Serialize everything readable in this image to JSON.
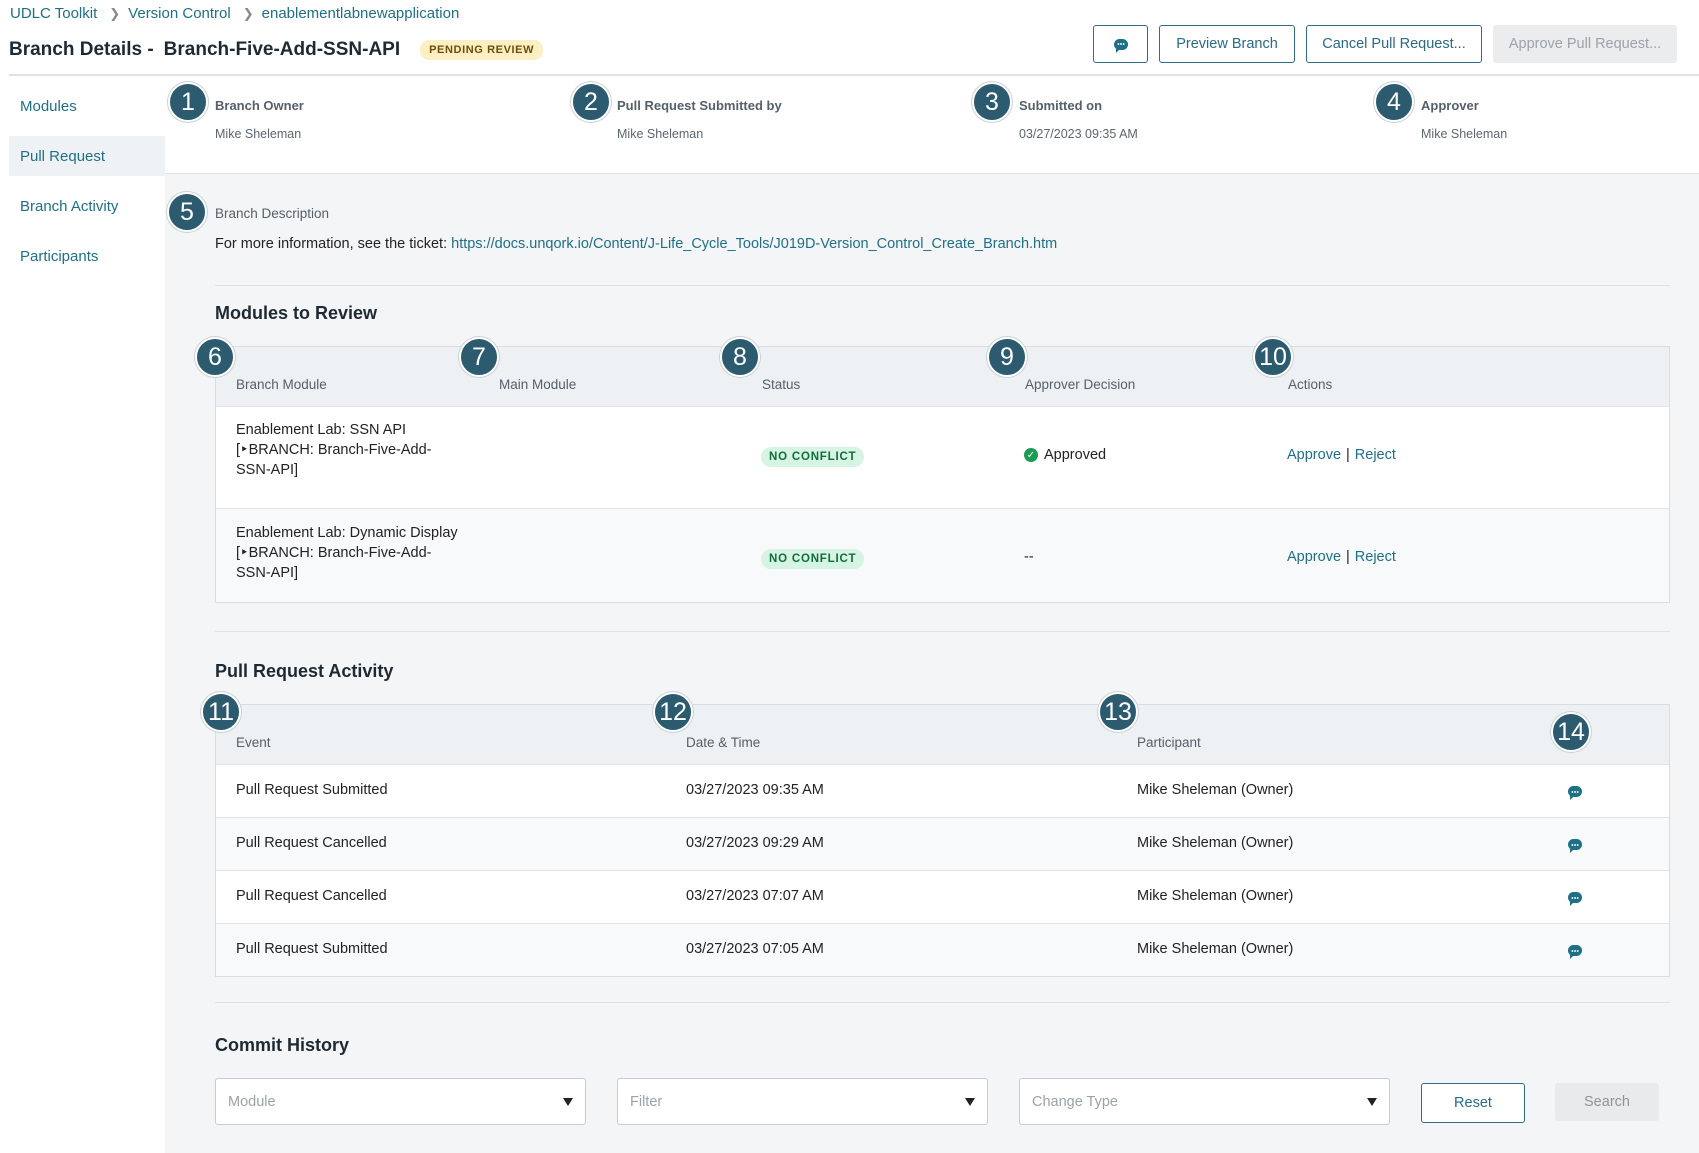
{
  "breadcrumb": [
    "UDLC Toolkit",
    "Version Control",
    "enablementlabnewapplication"
  ],
  "header": {
    "title_prefix": "Branch Details -",
    "branch_name": "Branch-Five-Add-SSN-API",
    "status_badge": "PENDING REVIEW"
  },
  "actions": {
    "comment_icon": "comment-icon",
    "preview": "Preview Branch",
    "cancel": "Cancel Pull Request...",
    "approve": "Approve Pull Request..."
  },
  "sidebar": {
    "items": [
      {
        "label": "Modules",
        "active": false
      },
      {
        "label": "Pull Request",
        "active": true
      },
      {
        "label": "Branch Activity",
        "active": false
      },
      {
        "label": "Participants",
        "active": false
      }
    ]
  },
  "info": [
    {
      "num": "1",
      "label": "Branch Owner",
      "value": "Mike Sheleman"
    },
    {
      "num": "2",
      "label": "Pull Request Submitted by",
      "value": "Mike Sheleman"
    },
    {
      "num": "3",
      "label": "Submitted on",
      "value": "03/27/2023 09:35 AM"
    },
    {
      "num": "4",
      "label": "Approver",
      "value": "Mike Sheleman"
    }
  ],
  "description": {
    "num": "5",
    "label": "Branch Description",
    "text": "For more information, see the ticket:",
    "link": "https://docs.unqork.io/Content/J-Life_Cycle_Tools/J019D-Version_Control_Create_Branch.htm"
  },
  "modules_review": {
    "title": "Modules to Review",
    "nums": [
      "6",
      "7",
      "8",
      "9",
      "10"
    ],
    "columns": [
      "Branch Module",
      "Main Module",
      "Status",
      "Approver Decision",
      "Actions"
    ],
    "rows": [
      {
        "branch_module": "Enablement Lab: SSN API [‣BRANCH: Branch-Five-Add-SSN-API]",
        "main_module": "",
        "status": "NO CONFLICT",
        "decision": "Approved",
        "approve": "Approve",
        "sep": "|",
        "reject": "Reject"
      },
      {
        "branch_module": "Enablement Lab: Dynamic Display [‣BRANCH: Branch-Five-Add-SSN-API]",
        "main_module": "",
        "status": "NO CONFLICT",
        "decision": "--",
        "approve": "Approve",
        "sep": "|",
        "reject": "Reject"
      }
    ]
  },
  "activity": {
    "title": "Pull Request Activity",
    "nums": [
      "11",
      "12",
      "13",
      "14"
    ],
    "columns": [
      "Event",
      "Date & Time",
      "Participant"
    ],
    "rows": [
      {
        "event": "Pull Request Submitted",
        "datetime": "03/27/2023 09:35 AM",
        "participant": "Mike Sheleman (Owner)"
      },
      {
        "event": "Pull Request Cancelled",
        "datetime": "03/27/2023 09:29 AM",
        "participant": "Mike Sheleman (Owner)"
      },
      {
        "event": "Pull Request Cancelled",
        "datetime": "03/27/2023 07:07 AM",
        "participant": "Mike Sheleman (Owner)"
      },
      {
        "event": "Pull Request Submitted",
        "datetime": "03/27/2023 07:05 AM",
        "participant": "Mike Sheleman (Owner)"
      }
    ]
  },
  "commit_history": {
    "title": "Commit History",
    "module_placeholder": "Module",
    "filter_placeholder": "Filter",
    "change_type_placeholder": "Change Type",
    "reset": "Reset",
    "search": "Search"
  }
}
